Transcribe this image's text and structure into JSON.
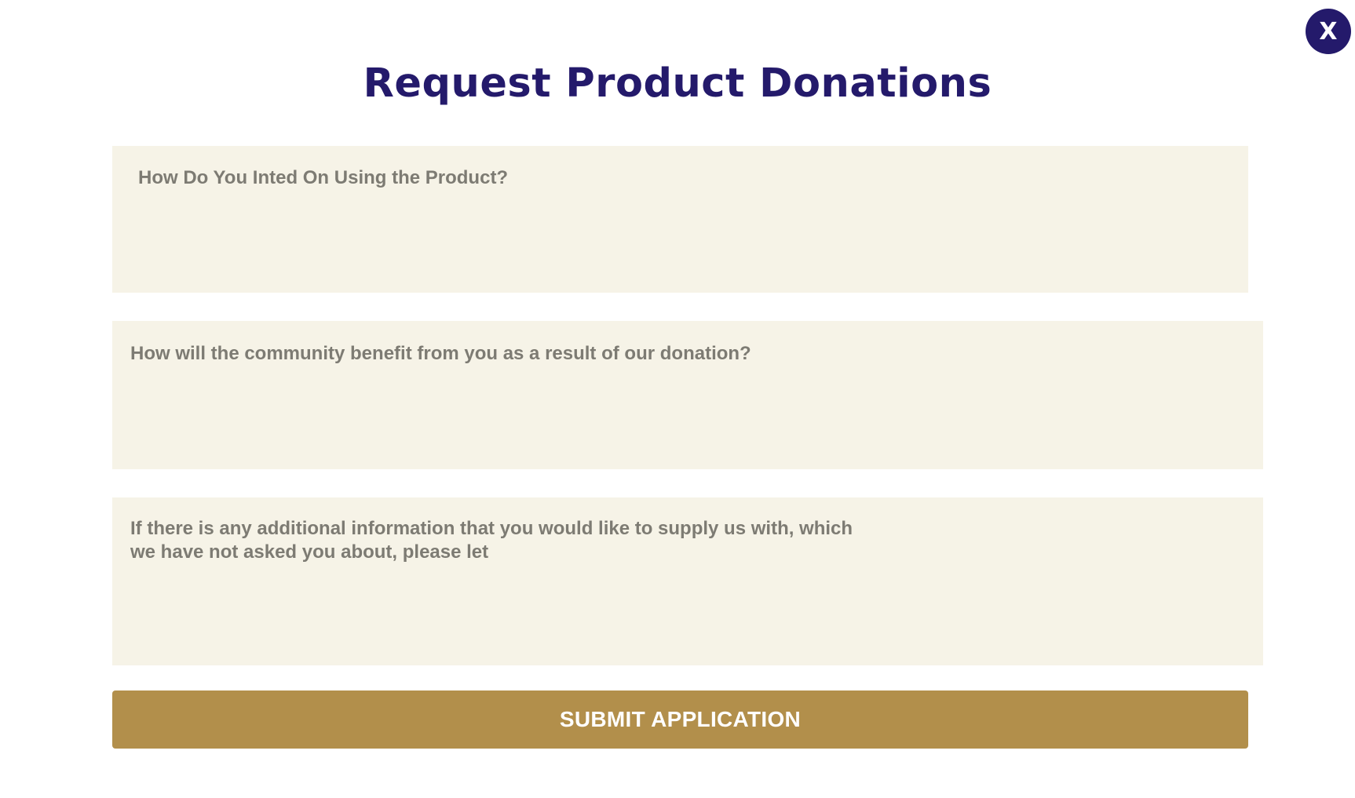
{
  "modal": {
    "close_label": "X",
    "title": "Request Product Donations",
    "fields": [
      {
        "placeholder": "How Do You Inted On Using the Product?",
        "value": ""
      },
      {
        "placeholder": "How will the community benefit from you as a result of our donation?",
        "value": ""
      },
      {
        "placeholder": "If there is any additional information that you would like to supply us with, which we have not asked you about, please let",
        "value": ""
      }
    ],
    "submit_label": "SUBMIT APPLICATION"
  },
  "colors": {
    "primary": "#241a6b",
    "field_background": "#f6f3e7",
    "placeholder_text": "#7d7b73",
    "submit_background": "#b28f4b"
  },
  "icons": {
    "close": "close-icon"
  }
}
